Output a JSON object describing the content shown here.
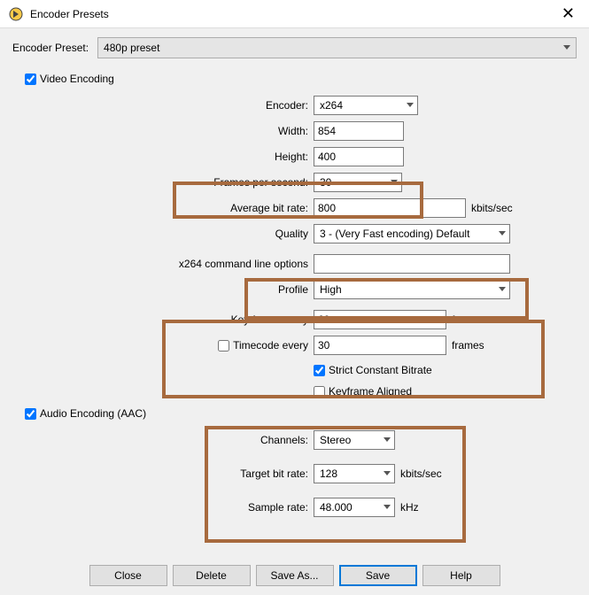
{
  "window": {
    "title": "Encoder Presets",
    "close": "✕"
  },
  "preset": {
    "label": "Encoder Preset:",
    "value": "480p preset"
  },
  "video": {
    "section_label": "Video Encoding",
    "encoder_label": "Encoder:",
    "encoder_value": "x264",
    "width_label": "Width:",
    "width_value": "854",
    "height_label": "Height:",
    "height_value": "400",
    "fps_label": "Frames per second:",
    "fps_value": "30",
    "abr_label": "Average bit rate:",
    "abr_value": "800",
    "abr_unit": "kbits/sec",
    "quality_label": "Quality",
    "quality_value": "3 - (Very Fast encoding) Default",
    "cmdline_label": "x264 command line options",
    "cmdline_value": "",
    "profile_label": "Profile",
    "profile_value": "High",
    "keyframe_label": "Key frame every",
    "keyframe_value": "60",
    "keyframe_unit": "frames",
    "timecode_label": "Timecode every",
    "timecode_value": "30",
    "timecode_unit": "frames",
    "strict_label": "Strict Constant Bitrate",
    "aligned_label": "Keyframe Aligned"
  },
  "audio": {
    "section_label": "Audio Encoding (AAC)",
    "channels_label": "Channels:",
    "channels_value": "Stereo",
    "bitrate_label": "Target bit rate:",
    "bitrate_value": "128",
    "bitrate_unit": "kbits/sec",
    "samplerate_label": "Sample rate:",
    "samplerate_value": "48.000",
    "samplerate_unit": "kHz"
  },
  "buttons": {
    "close": "Close",
    "delete": "Delete",
    "saveas": "Save As...",
    "save": "Save",
    "help": "Help"
  }
}
